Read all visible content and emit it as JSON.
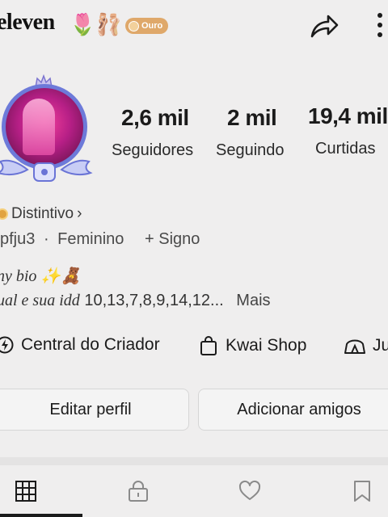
{
  "profile": {
    "username": "eleven",
    "emojis": [
      "🌷",
      "🩰"
    ],
    "level_badge": "Ouro"
  },
  "stats": [
    {
      "value": "2,6 mil",
      "label": "Seguidores"
    },
    {
      "value": "2 mil",
      "label": "Seguindo"
    },
    {
      "value": "19,4 mil",
      "label": "Curtidas"
    }
  ],
  "info": {
    "distintivo": "Distintivo",
    "chevron": "›",
    "id": "pfju3",
    "separator": "·",
    "gender": "Feminino",
    "sign": "+ Signo",
    "bio_line1": "ny bio ✨🧸",
    "bio_line2_italic": "ual e sua idd",
    "bio_line2_numbers": "10,13,7,8,9,14,12...",
    "more": "Mais"
  },
  "links": [
    {
      "label": "Central do Criador",
      "icon": "creator-center-icon"
    },
    {
      "label": "Kwai Shop",
      "icon": "shopping-bag-icon"
    },
    {
      "label": "Ju",
      "icon": "tent-icon"
    }
  ],
  "buttons": {
    "edit": "Editar perfil",
    "add_friends": "Adicionar amigos"
  },
  "tabs": [
    {
      "name": "grid-icon",
      "active": true
    },
    {
      "name": "lock-icon",
      "active": false
    },
    {
      "name": "heart-icon",
      "active": false
    },
    {
      "name": "bookmark-icon",
      "active": false
    }
  ],
  "colors": {
    "background": "#efeeee",
    "badge": "#dfa86a",
    "avatar_ring": "#6d7ad9",
    "text": "#1b1b1b"
  }
}
